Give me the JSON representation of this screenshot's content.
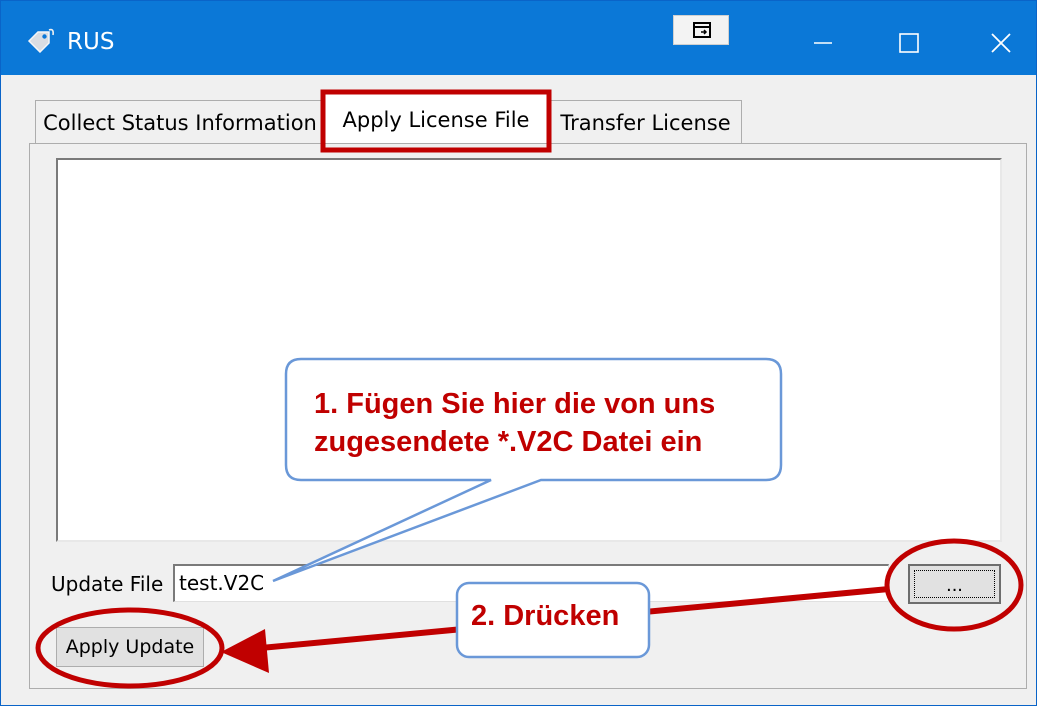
{
  "window": {
    "title": "RUS",
    "icons": {
      "app": "key-tag-icon",
      "snap": "snap-layout-icon",
      "minimize": "minimize-icon",
      "maximize": "maximize-icon",
      "close": "close-icon"
    }
  },
  "tabs": [
    {
      "label": "Collect Status Information",
      "selected": false
    },
    {
      "label": "Apply License File",
      "selected": true
    },
    {
      "label": "Transfer License",
      "selected": false
    }
  ],
  "form": {
    "update_file_label": "Update File",
    "update_file_value": "test.V2C",
    "browse_label": "...",
    "apply_label": "Apply Update"
  },
  "annotations": {
    "callout1_line1": "1. Fügen Sie hier die von uns",
    "callout1_line2": "zugesendete *.V2C Datei ein",
    "callout2": "2. Drücken"
  },
  "colors": {
    "titlebar": "#0b78d7",
    "highlight": "#c00000",
    "callout_border": "#6a98d8",
    "arrow": "#c00000"
  }
}
